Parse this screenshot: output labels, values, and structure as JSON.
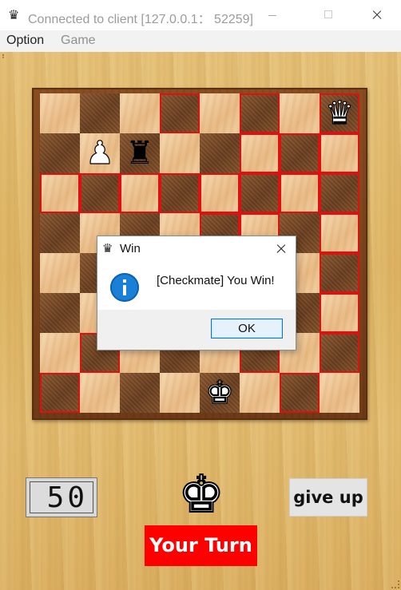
{
  "window": {
    "title": "Connected to client [127.0.0.1： 52259]",
    "icon": "crown-icon"
  },
  "menu": {
    "items": [
      "Option",
      "Game"
    ]
  },
  "board": {
    "highlight_color": "#e01010",
    "squares": [
      {
        "r": 0,
        "c": 3,
        "hl": true
      },
      {
        "r": 0,
        "c": 5,
        "hl": true
      },
      {
        "r": 0,
        "c": 7,
        "hl": true,
        "piece": "♛",
        "color": "white"
      },
      {
        "r": 1,
        "c": 1,
        "piece": "♟",
        "color": "white"
      },
      {
        "r": 1,
        "c": 2,
        "piece": "♜",
        "color": "black"
      },
      {
        "r": 1,
        "c": 5,
        "hl": true
      },
      {
        "r": 1,
        "c": 6,
        "hl": true
      },
      {
        "r": 1,
        "c": 7,
        "hl": true
      },
      {
        "r": 2,
        "c": 0,
        "hl": true
      },
      {
        "r": 2,
        "c": 1,
        "hl": true
      },
      {
        "r": 2,
        "c": 2,
        "hl": true
      },
      {
        "r": 2,
        "c": 3,
        "hl": true
      },
      {
        "r": 2,
        "c": 4,
        "hl": true
      },
      {
        "r": 2,
        "c": 5,
        "hl": true
      },
      {
        "r": 2,
        "c": 6,
        "hl": true
      },
      {
        "r": 2,
        "c": 7,
        "hl": true
      },
      {
        "r": 3,
        "c": 4,
        "hl": true
      },
      {
        "r": 3,
        "c": 5,
        "hl": true
      },
      {
        "r": 3,
        "c": 7,
        "hl": true
      },
      {
        "r": 4,
        "c": 3,
        "hl": true
      },
      {
        "r": 4,
        "c": 5,
        "hl": true
      },
      {
        "r": 4,
        "c": 7,
        "hl": true
      },
      {
        "r": 5,
        "c": 2,
        "hl": true
      },
      {
        "r": 5,
        "c": 5,
        "hl": true
      },
      {
        "r": 5,
        "c": 7,
        "hl": true
      },
      {
        "r": 6,
        "c": 1,
        "hl": true
      },
      {
        "r": 6,
        "c": 5,
        "hl": true
      },
      {
        "r": 6,
        "c": 7,
        "hl": true
      },
      {
        "r": 7,
        "c": 0,
        "hl": true
      },
      {
        "r": 7,
        "c": 4,
        "piece": "♚",
        "color": "white"
      },
      {
        "r": 7,
        "c": 6,
        "hl": true
      }
    ]
  },
  "dialog": {
    "title": "Win",
    "title_icon": "crown-icon",
    "message": "[Checkmate] You Win!",
    "message_icon": "info-icon",
    "ok_label": "OK"
  },
  "status": {
    "timer": "50",
    "player_piece": "♚",
    "give_up_label": "give up",
    "turn_label": "Your Turn",
    "turn_color": "#ff0000"
  }
}
